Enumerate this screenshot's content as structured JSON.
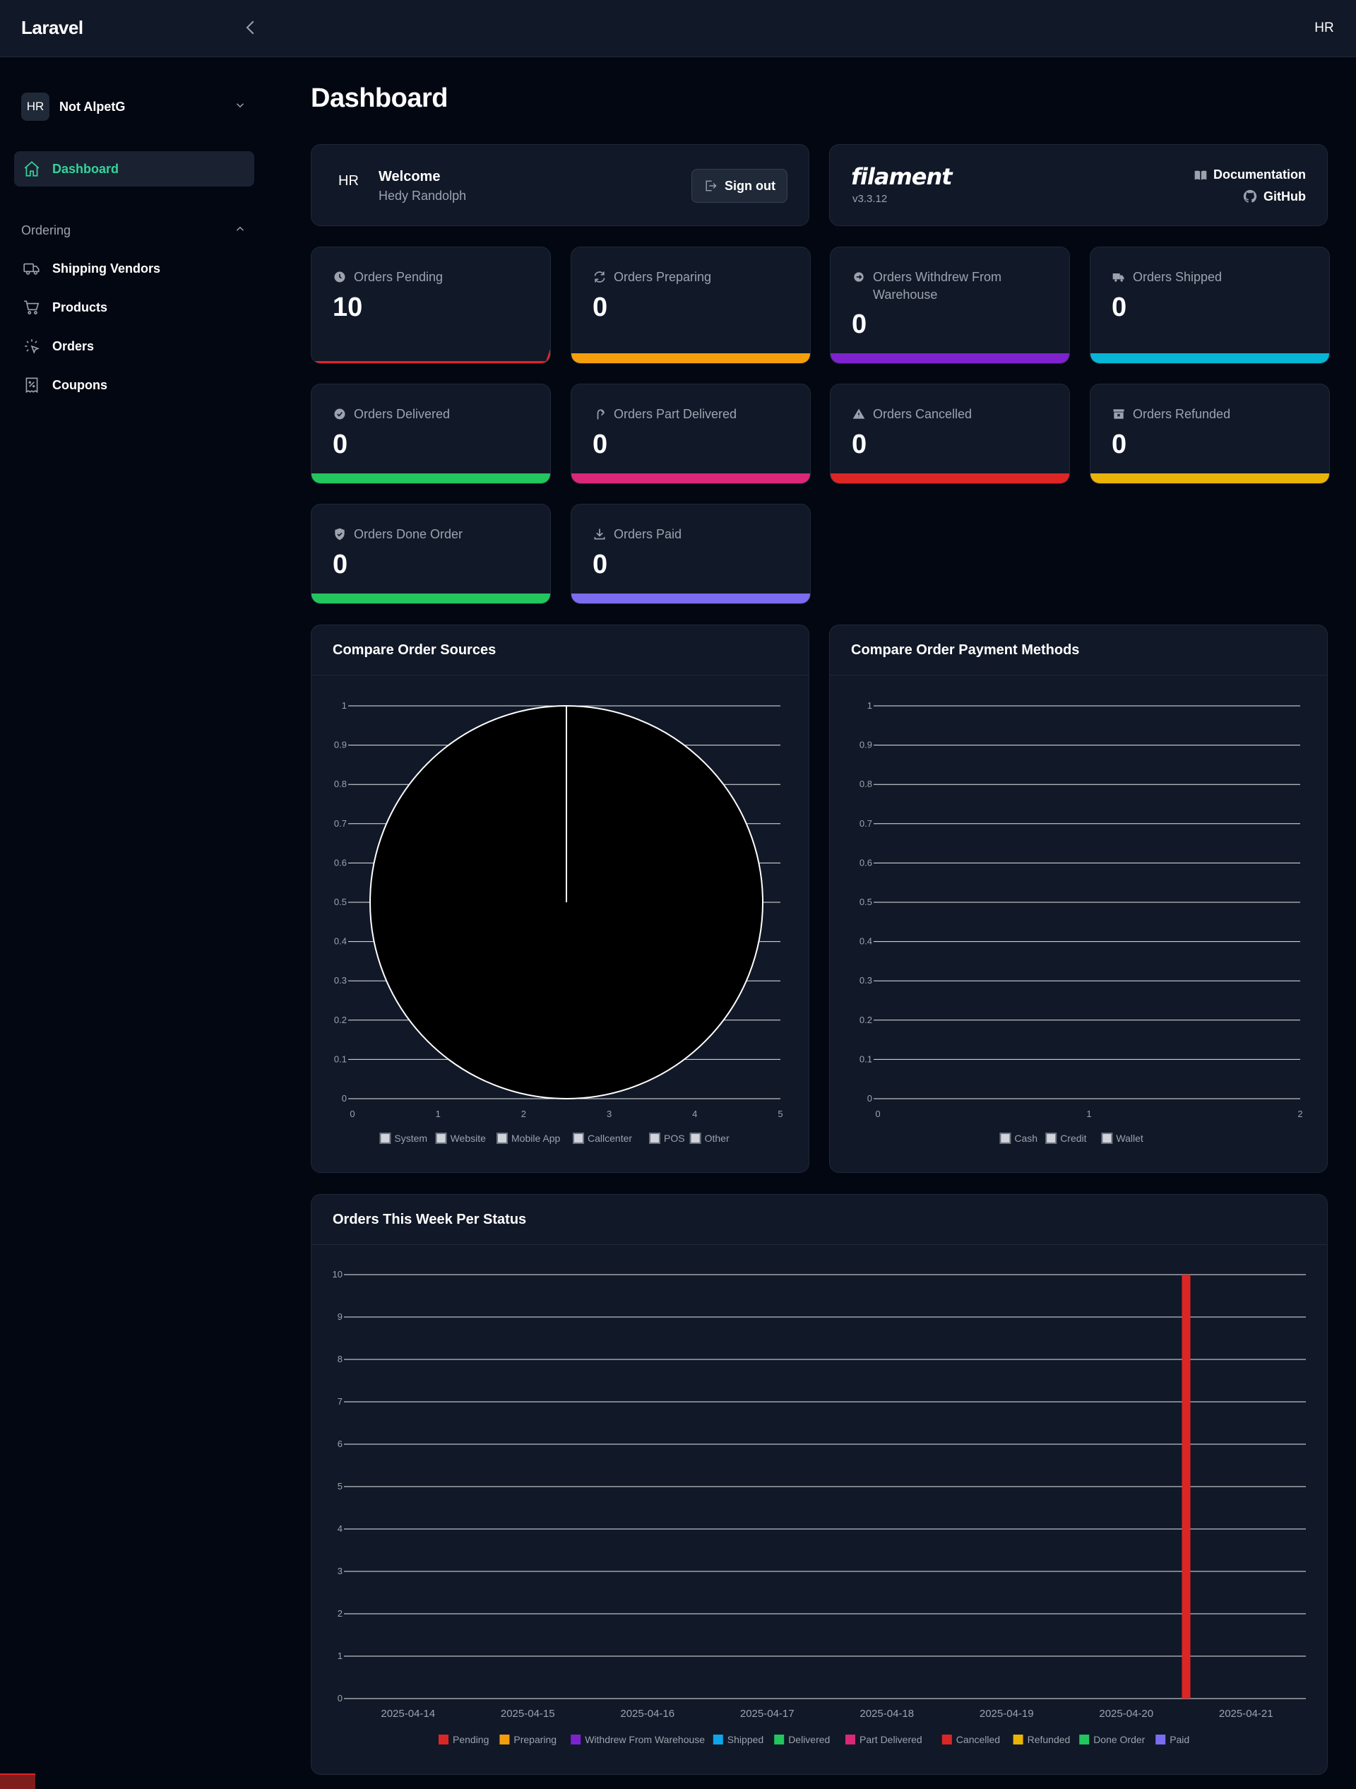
{
  "brand": "Laravel",
  "user_initials": "HR",
  "tenant": {
    "initials": "HR",
    "name": "Not AlpetG"
  },
  "nav": {
    "dashboard": "Dashboard",
    "group": "Ordering",
    "items": [
      "Shipping Vendors",
      "Products",
      "Orders",
      "Coupons"
    ]
  },
  "page_title": "Dashboard",
  "welcome": {
    "initials": "HR",
    "title": "Welcome",
    "name": "Hedy Randolph",
    "sign_out": "Sign out"
  },
  "filament": {
    "logo": "filament",
    "version": "v3.3.12",
    "documentation": "Documentation",
    "github": "GitHub"
  },
  "stats": [
    {
      "label": "Orders Pending",
      "value": "10",
      "color": "#dc2626",
      "icon": "clock-icon"
    },
    {
      "label": "Orders Preparing",
      "value": "0",
      "color": "#f59e0b",
      "icon": "refresh-icon"
    },
    {
      "label": "Orders Withdrew From Warehouse",
      "value": "0",
      "color": "#7e22ce",
      "icon": "arrow-circle-icon"
    },
    {
      "label": "Orders Shipped",
      "value": "0",
      "color": "#06b6d4",
      "icon": "truck-icon"
    },
    {
      "label": "Orders Delivered",
      "value": "0",
      "color": "#22c55e",
      "icon": "check-circle-icon"
    },
    {
      "label": "Orders Part Delivered",
      "value": "0",
      "color": "#db2777",
      "icon": "arrow-uturn-icon"
    },
    {
      "label": "Orders Cancelled",
      "value": "0",
      "color": "#dc2626",
      "icon": "warning-icon"
    },
    {
      "label": "Orders Refunded",
      "value": "0",
      "color": "#eab308",
      "icon": "archive-x-icon"
    },
    {
      "label": "Orders Done Order",
      "value": "0",
      "color": "#22c55e",
      "icon": "shield-check-icon"
    },
    {
      "label": "Orders Paid",
      "value": "0",
      "color": "#7c6cf0",
      "icon": "download-icon"
    }
  ],
  "chart_data": [
    {
      "title": "Compare Order Sources",
      "type": "pie",
      "categories": [
        "System",
        "Website",
        "Mobile App",
        "Callcenter",
        "POS",
        "Other"
      ],
      "values": [
        1,
        0,
        0,
        0,
        0,
        0
      ],
      "y_ticks": [
        "0",
        "0.1",
        "0.2",
        "0.3",
        "0.4",
        "0.5",
        "0.6",
        "0.7",
        "0.8",
        "0.9",
        "1"
      ],
      "x_ticks": [
        "0",
        "1",
        "2",
        "3",
        "4",
        "5"
      ],
      "ylim": [
        0,
        1
      ],
      "legend_position": "bottom"
    },
    {
      "title": "Compare Order Payment Methods",
      "type": "pie",
      "categories": [
        "Cash",
        "Credit",
        "Wallet"
      ],
      "values": [
        0,
        0,
        0
      ],
      "y_ticks": [
        "0",
        "0.1",
        "0.2",
        "0.3",
        "0.4",
        "0.5",
        "0.6",
        "0.7",
        "0.8",
        "0.9",
        "1"
      ],
      "x_ticks": [
        "0",
        "1",
        "2"
      ],
      "ylim": [
        0,
        1
      ],
      "legend_position": "bottom"
    },
    {
      "title": "Orders This Week Per Status",
      "type": "bar",
      "categories": [
        "2025-04-14",
        "2025-04-15",
        "2025-04-16",
        "2025-04-17",
        "2025-04-18",
        "2025-04-19",
        "2025-04-20",
        "2025-04-21"
      ],
      "series": [
        {
          "name": "Pending",
          "color": "#dc2626",
          "values": [
            0,
            0,
            0,
            0,
            0,
            0,
            0,
            10
          ]
        },
        {
          "name": "Preparing",
          "color": "#f59e0b",
          "values": [
            0,
            0,
            0,
            0,
            0,
            0,
            0,
            0
          ]
        },
        {
          "name": "Withdrew From Warehouse",
          "color": "#7e22ce",
          "values": [
            0,
            0,
            0,
            0,
            0,
            0,
            0,
            0
          ]
        },
        {
          "name": "Shipped",
          "color": "#0ea5e9",
          "values": [
            0,
            0,
            0,
            0,
            0,
            0,
            0,
            0
          ]
        },
        {
          "name": "Delivered",
          "color": "#22c55e",
          "values": [
            0,
            0,
            0,
            0,
            0,
            0,
            0,
            0
          ]
        },
        {
          "name": "Part Delivered",
          "color": "#db2777",
          "values": [
            0,
            0,
            0,
            0,
            0,
            0,
            0,
            0
          ]
        },
        {
          "name": "Cancelled",
          "color": "#dc2626",
          "values": [
            0,
            0,
            0,
            0,
            0,
            0,
            0,
            0
          ]
        },
        {
          "name": "Refunded",
          "color": "#eab308",
          "values": [
            0,
            0,
            0,
            0,
            0,
            0,
            0,
            0
          ]
        },
        {
          "name": "Done Order",
          "color": "#22c55e",
          "values": [
            0,
            0,
            0,
            0,
            0,
            0,
            0,
            0
          ]
        },
        {
          "name": "Paid",
          "color": "#7c6cf0",
          "values": [
            0,
            0,
            0,
            0,
            0,
            0,
            0,
            0
          ]
        }
      ],
      "y_ticks": [
        "0",
        "1",
        "2",
        "3",
        "4",
        "5",
        "6",
        "7",
        "8",
        "9",
        "10"
      ],
      "ylim": [
        0,
        10
      ],
      "legend_position": "bottom"
    }
  ]
}
